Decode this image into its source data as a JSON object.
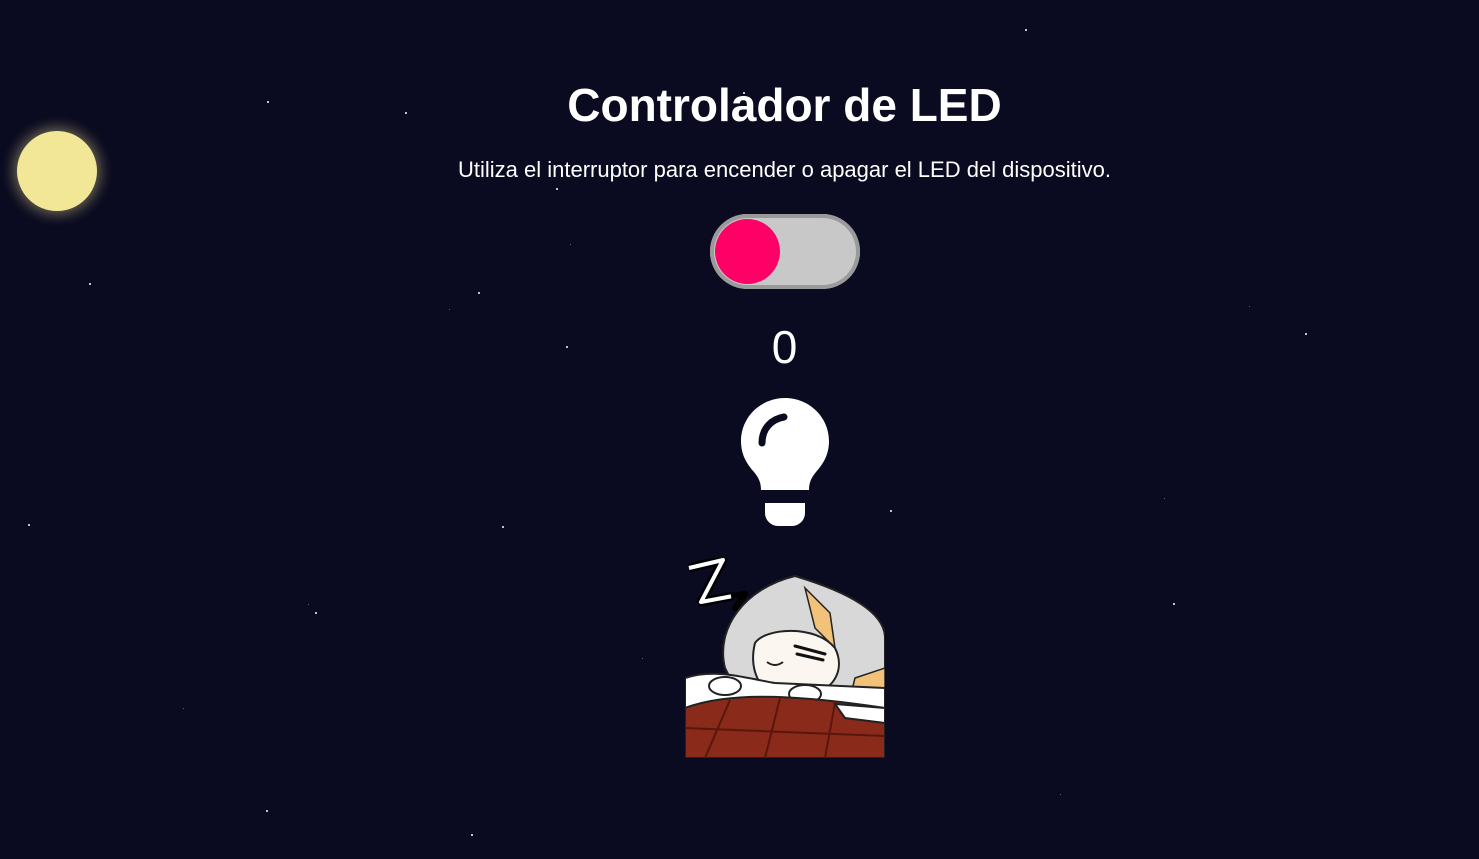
{
  "header": {
    "title": "Controlador de LED",
    "subtitle": "Utiliza el interruptor para encender o apagar el LED del dispositivo."
  },
  "led_switch": {
    "state": "off",
    "knob_color": "#ff0066",
    "track_color": "#c8c8c8"
  },
  "status": {
    "value": "0"
  },
  "icons": {
    "moon": "moon-icon",
    "bulb": "lightbulb-icon",
    "illustration": "sleeping-character-illustration"
  },
  "colors": {
    "background": "#0a0a20",
    "moon": "#f2e796",
    "text": "#ffffff"
  }
}
